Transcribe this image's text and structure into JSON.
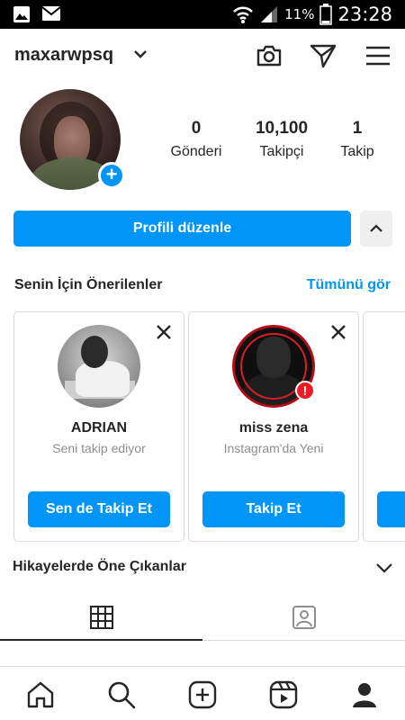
{
  "status_bar": {
    "battery_percent": "11%",
    "time": "23:28"
  },
  "header": {
    "username": "maxarwpsq"
  },
  "profile": {
    "stats": [
      {
        "value": "0",
        "label": "Gönderi"
      },
      {
        "value": "10,100",
        "label": "Takipçi"
      },
      {
        "value": "1",
        "label": "Takip"
      }
    ],
    "edit_profile_label": "Profili düzenle"
  },
  "suggestions": {
    "title": "Senin İçin Önerilenler",
    "see_all_label": "Tümünü gör",
    "cards": [
      {
        "name": "ADRIAN",
        "subtitle": "Seni takip ediyor",
        "button_label": "Sen de Takip Et"
      },
      {
        "name": "miss zena",
        "subtitle": "Instagram'da Yeni",
        "button_label": "Takip Et"
      }
    ]
  },
  "highlights": {
    "title": "Hikayelerde Öne Çıkanlar"
  },
  "colors": {
    "accent": "#0095f6",
    "text": "#262626",
    "muted": "#8e8e8e",
    "border": "#dbdbdb",
    "status_bar": "#000000"
  },
  "icons": {
    "status_left": [
      "gallery-icon",
      "mail-icon"
    ],
    "status_right": [
      "wifi-icon",
      "signal-icon",
      "battery-icon"
    ],
    "header": [
      "camera-icon",
      "direct-send-icon",
      "menu-icon"
    ],
    "tabs": [
      "grid-icon",
      "tagged-icon"
    ],
    "bottom_nav": [
      "home-icon",
      "search-icon",
      "add-post-icon",
      "reels-icon",
      "profile-icon"
    ]
  }
}
